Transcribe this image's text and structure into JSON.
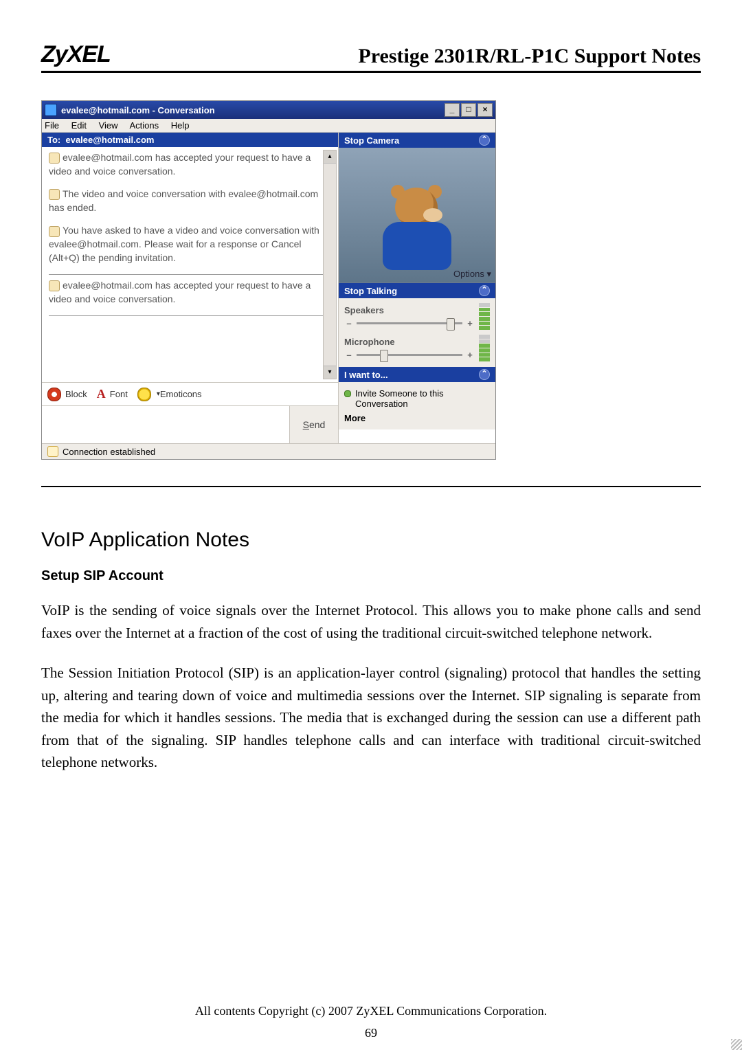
{
  "header": {
    "logo": "ZyXEL",
    "doc_title": "Prestige 2301R/RL-P1C Support Notes"
  },
  "msn": {
    "title": "evalee@hotmail.com - Conversation",
    "menu": {
      "file": "File",
      "edit": "Edit",
      "view": "View",
      "actions": "Actions",
      "help": "Help"
    },
    "to_label": "To:",
    "to_value": "evalee@hotmail.com",
    "messages": [
      "evalee@hotmail.com has accepted your request to have a video and voice conversation.",
      "The video and voice conversation with evalee@hotmail.com has ended.",
      "You have asked to have a video and voice conversation with evalee@hotmail.com. Please wait for a response or Cancel (Alt+Q) the pending invitation.",
      "evalee@hotmail.com has accepted your request to have a video and voice conversation."
    ],
    "toolbar": {
      "block": "Block",
      "font": "Font",
      "font_icon": "A",
      "emoticons": "Emoticons"
    },
    "send": "Send",
    "right": {
      "stop_camera": "Stop Camera",
      "options": "Options",
      "stop_talking": "Stop Talking",
      "speakers": "Speakers",
      "microphone": "Microphone",
      "i_want_to": "I want to...",
      "invite": "Invite Someone to this Conversation",
      "more": "More"
    },
    "status": "Connection established"
  },
  "content": {
    "section": "VoIP Application Notes",
    "subsection": "Setup SIP Account",
    "para1": "VoIP is the sending of voice signals over the Internet Protocol. This allows you to make phone calls and send faxes over the Internet at a fraction of the cost of using the traditional circuit-switched telephone network.",
    "para2": "The Session Initiation Protocol (SIP) is an application-layer control (signaling) protocol that handles the setting up, altering and tearing down of voice and multimedia sessions over the Internet. SIP signaling is separate from the media for which it handles sessions. The media that is exchanged during the session can use a different path from that of the signaling. SIP handles telephone calls and can interface with traditional circuit-switched telephone networks."
  },
  "footer": {
    "copyright": "All contents Copyright (c) 2007 ZyXEL Communications Corporation.",
    "page": "69"
  }
}
